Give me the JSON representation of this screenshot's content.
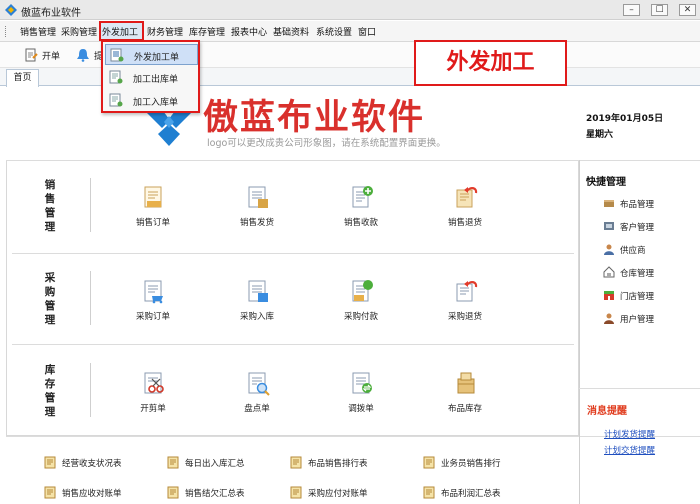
{
  "window": {
    "title": "傲蓝布业软件",
    "min_glyph": "–",
    "max_glyph": "☐",
    "close_glyph": "✕"
  },
  "menu": {
    "items": [
      "销售管理",
      "采购管理",
      "外发加工",
      "财务管理",
      "库存管理",
      "报表中心",
      "基础资料",
      "系统设置",
      "窗口"
    ],
    "active": "外发加工"
  },
  "toolbar": {
    "items": [
      {
        "label": "开单",
        "icon": "open-order-icon"
      },
      {
        "label": "提",
        "icon": "bell-icon"
      }
    ]
  },
  "tabs": [
    "首页"
  ],
  "dropdown": {
    "items": [
      {
        "label": "外发加工单",
        "icon": "processing-order-icon",
        "selected": true
      },
      {
        "label": "加工出库单",
        "icon": "outbound-icon",
        "selected": false
      },
      {
        "label": "加工入库单",
        "icon": "inbound-icon",
        "selected": false
      }
    ]
  },
  "callout": "外发加工",
  "brand": {
    "name": "傲蓝布业软件",
    "subtitle": "logo可以更改成贵公司形象图，请在系统配置界面更换。"
  },
  "date": {
    "date": "2019年01月05日",
    "weekday": "星期六"
  },
  "sections": [
    {
      "name": "销售管理",
      "items": [
        {
          "label": "销售订单",
          "icon": "sales-order-icon"
        },
        {
          "label": "销售发货",
          "icon": "sales-delivery-icon"
        },
        {
          "label": "销售收款",
          "icon": "sales-receipt-icon"
        },
        {
          "label": "销售退货",
          "icon": "sales-return-icon"
        }
      ]
    },
    {
      "name": "采购管理",
      "items": [
        {
          "label": "采购订单",
          "icon": "purchase-order-icon"
        },
        {
          "label": "采购入库",
          "icon": "purchase-inbound-icon"
        },
        {
          "label": "采购付款",
          "icon": "purchase-payment-icon"
        },
        {
          "label": "采购退货",
          "icon": "purchase-return-icon"
        }
      ]
    },
    {
      "name": "库存管理",
      "items": [
        {
          "label": "开剪单",
          "icon": "cut-order-icon"
        },
        {
          "label": "盘点单",
          "icon": "stocktake-icon"
        },
        {
          "label": "调拨单",
          "icon": "transfer-icon"
        },
        {
          "label": "布品库存",
          "icon": "fabric-stock-icon"
        }
      ]
    }
  ],
  "quick": {
    "title": "快捷管理",
    "items": [
      {
        "label": "布品管理",
        "icon": "fabric-icon"
      },
      {
        "label": "客户管理",
        "icon": "customer-icon"
      },
      {
        "label": "供应商",
        "icon": "supplier-icon"
      },
      {
        "label": "仓库管理",
        "icon": "warehouse-icon"
      },
      {
        "label": "门店管理",
        "icon": "store-icon"
      },
      {
        "label": "用户管理",
        "icon": "user-icon"
      }
    ]
  },
  "messages": {
    "title": "消息提醒",
    "links": [
      "计划发货提醒",
      "计划交货提醒"
    ]
  },
  "reports": {
    "items": [
      "经营收支状况表",
      "每日出入库汇总",
      "布品销售排行表",
      "业务员销售排行",
      "销售应收对账单",
      "销售结欠汇总表",
      "采购应付对账单",
      "布品利润汇总表"
    ]
  },
  "colors": {
    "accent_red": "#e01a1a",
    "brand_red": "#d9302c",
    "logo_blue": "#1f7fd1",
    "link_blue": "#1f4fbf"
  }
}
